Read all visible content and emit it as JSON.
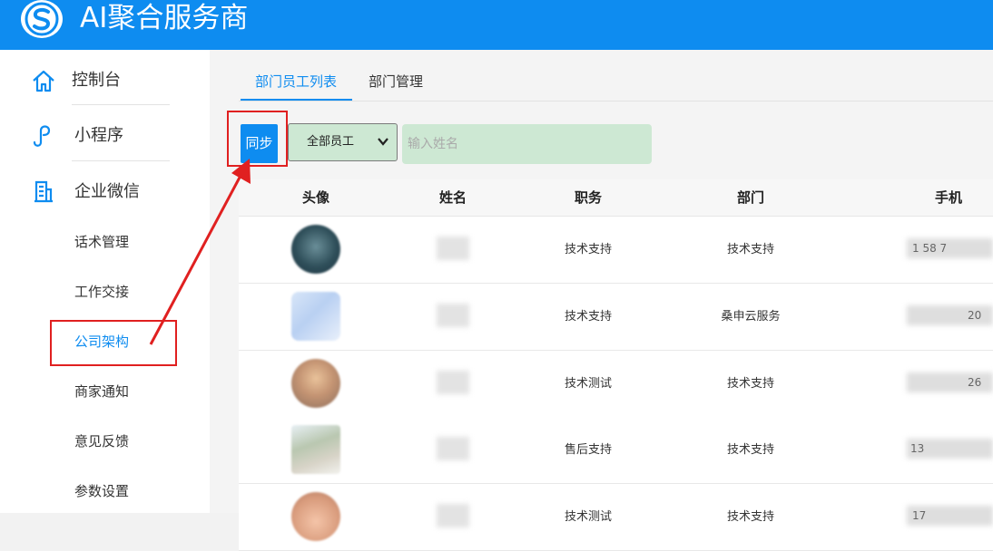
{
  "header": {
    "title": "AI聚合服务商"
  },
  "sidebar": {
    "main": [
      {
        "label": "控制台",
        "icon": "home-icon"
      },
      {
        "label": "小程序",
        "icon": "mini-program-icon"
      },
      {
        "label": "企业微信",
        "icon": "building-icon"
      }
    ],
    "sub": [
      "话术管理",
      "工作交接",
      "公司架构",
      "商家通知",
      "意见反馈",
      "参数设置"
    ],
    "active_sub": "公司架构"
  },
  "tabs": [
    {
      "label": "部门员工列表",
      "active": true
    },
    {
      "label": "部门管理",
      "active": false
    }
  ],
  "toolbar": {
    "sync_label": "同步",
    "filter_value": "全部员工",
    "name_placeholder": "输入姓名"
  },
  "table": {
    "columns": [
      "头像",
      "姓名",
      "职务",
      "部门",
      "手机"
    ],
    "rows": [
      {
        "position": "技术支持",
        "department": "技术支持",
        "phone": "1   58   7"
      },
      {
        "position": "技术支持",
        "department": "桑申云服务",
        "phone": "20"
      },
      {
        "position": "技术测试",
        "department": "技术支持",
        "phone": "26"
      },
      {
        "position": "售后支持",
        "department": "技术支持",
        "phone": "13"
      },
      {
        "position": "技术测试",
        "department": "技术支持",
        "phone": "17"
      }
    ]
  },
  "colors": {
    "brand": "#0e8cf0",
    "highlight": "#e02020",
    "input_bg": "#cde8d3"
  }
}
